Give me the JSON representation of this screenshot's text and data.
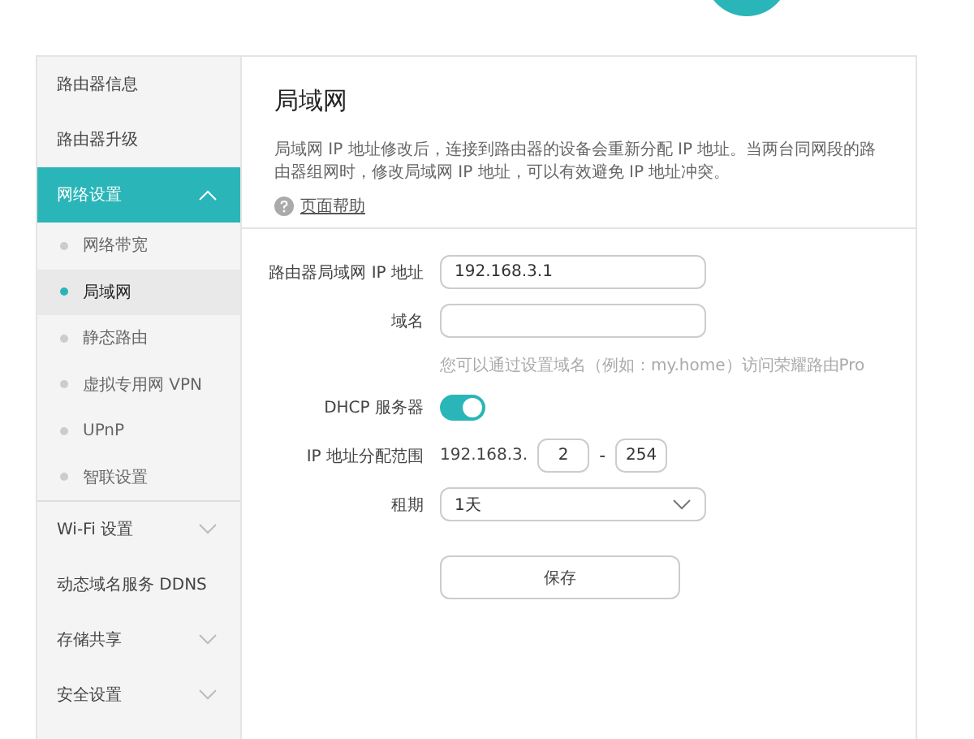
{
  "sidebar": {
    "items": [
      {
        "label": "路由器信息",
        "kind": "plain",
        "selected": false
      },
      {
        "label": "路由器升级",
        "kind": "plain",
        "selected": false
      },
      {
        "label": "网络设置",
        "kind": "group",
        "selected": true,
        "expanded": true,
        "children": [
          {
            "label": "网络带宽",
            "selected": false
          },
          {
            "label": "局域网",
            "selected": true
          },
          {
            "label": "静态路由",
            "selected": false
          },
          {
            "label": "虚拟专用网 VPN",
            "selected": false
          },
          {
            "label": "UPnP",
            "selected": false
          },
          {
            "label": "智联设置",
            "selected": false
          }
        ]
      },
      {
        "label": "Wi-Fi 设置",
        "kind": "group",
        "selected": false,
        "expanded": false
      },
      {
        "label": "动态域名服务 DDNS",
        "kind": "plain",
        "selected": false
      },
      {
        "label": "存储共享",
        "kind": "group",
        "selected": false,
        "expanded": false
      },
      {
        "label": "安全设置",
        "kind": "group",
        "selected": false,
        "expanded": false
      }
    ]
  },
  "page": {
    "title": "局域网",
    "description": "局域网 IP 地址修改后，连接到路由器的设备会重新分配 IP 地址。当两台同网段的路由器组网时，修改局域网 IP 地址，可以有效避免 IP 地址冲突。",
    "help_link": "页面帮助"
  },
  "form": {
    "lan_ip": {
      "label": "路由器局域网 IP 地址",
      "value": "192.168.3.1"
    },
    "domain": {
      "label": "域名",
      "hint": "您可以通过设置域名（例如：my.home）访问荣耀路由Pro"
    },
    "dhcp": {
      "label": "DHCP 服务器",
      "on": true
    },
    "range": {
      "label": "IP 地址分配范围",
      "prefix": "192.168.3.",
      "start": "2",
      "separator": "-",
      "end": "254"
    },
    "lease": {
      "label": "租期",
      "value": "1天"
    },
    "save_button": "保存"
  }
}
